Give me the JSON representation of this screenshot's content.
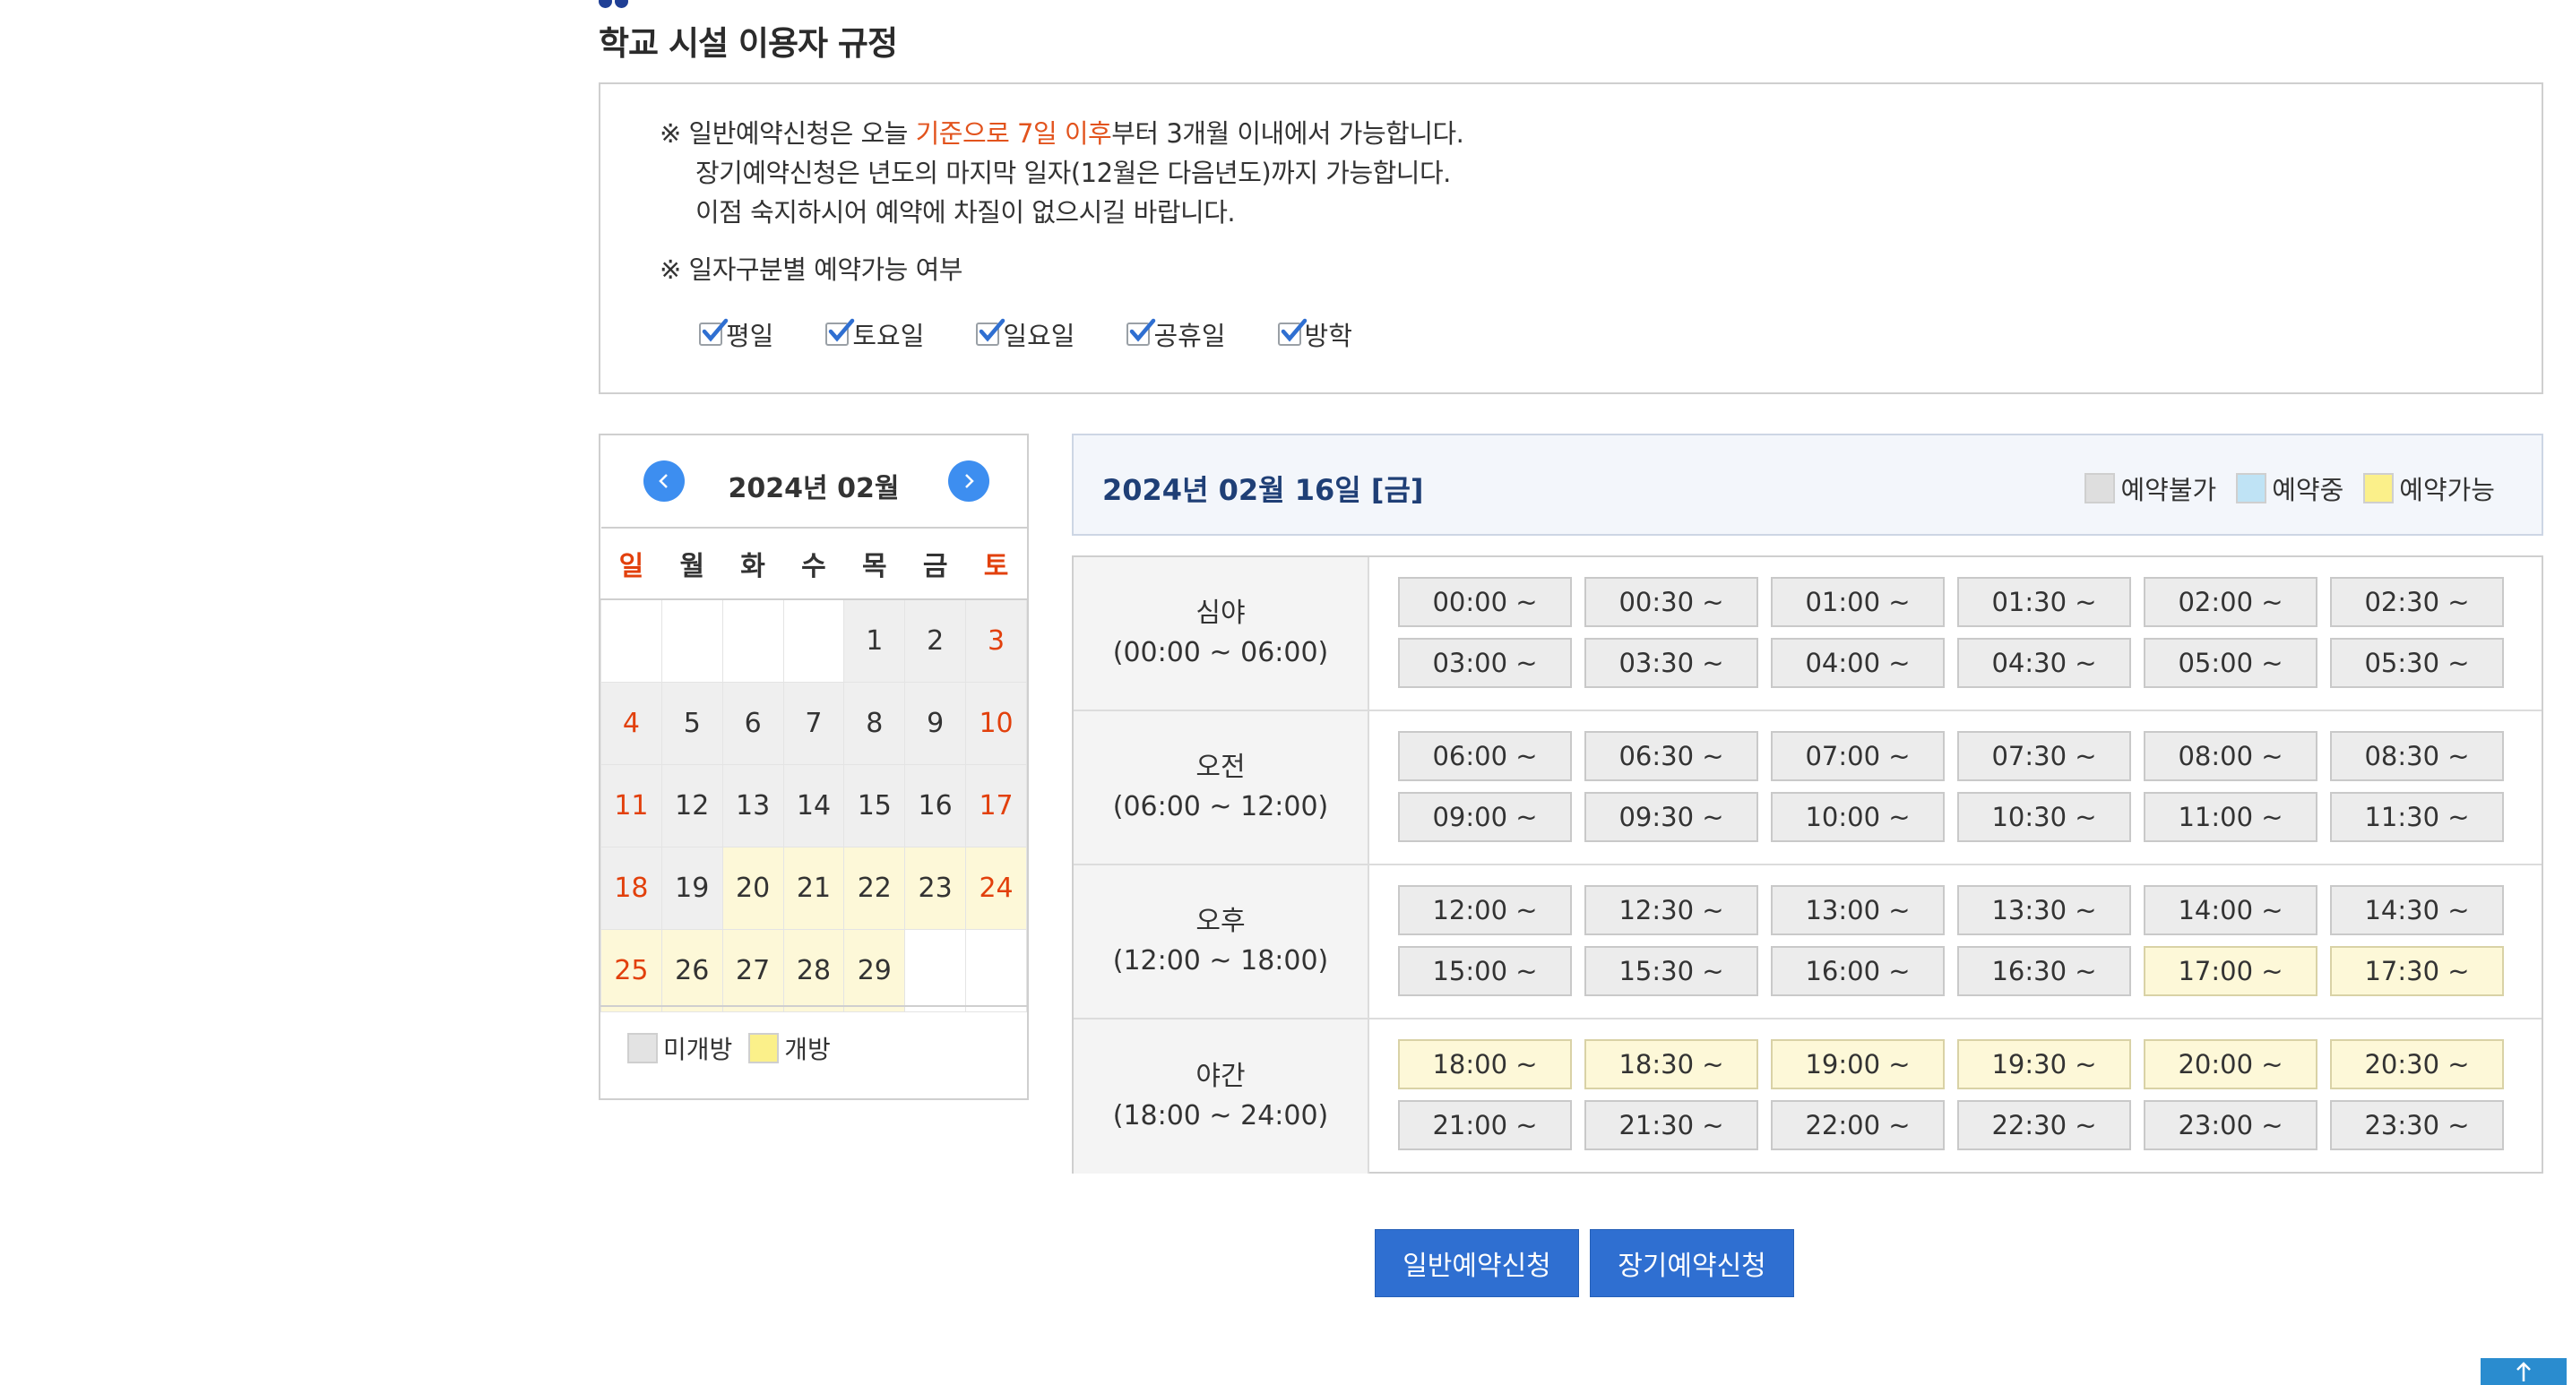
{
  "page": {
    "title": "학교 시설 이용자 규정"
  },
  "notice": {
    "line1_pre": "※ 일반예약신청은 오늘 ",
    "line1_highlight": "기준으로 7일 이후",
    "line1_post": "부터 3개월 이내에서 가능합니다.",
    "line2": "장기예약신청은 년도의 마지막 일자(12월은 다음년도)까지 가능합니다.",
    "line3": "이점 숙지하시어 예약에 차질이 없으시길 바랍니다.",
    "availability_heading": "※ 일자구분별 예약가능 여부",
    "options": [
      {
        "label": "평일",
        "checked": true
      },
      {
        "label": "토요일",
        "checked": true
      },
      {
        "label": "일요일",
        "checked": true
      },
      {
        "label": "공휴일",
        "checked": true
      },
      {
        "label": "방학",
        "checked": true
      }
    ]
  },
  "calendar": {
    "title": "2024년 02월",
    "prev_icon": "chevron-left-icon",
    "next_icon": "chevron-right-icon",
    "weekdays": [
      "일",
      "월",
      "화",
      "수",
      "목",
      "금",
      "토"
    ],
    "weeks": [
      [
        {
          "d": "",
          "s": "empty"
        },
        {
          "d": "",
          "s": "empty"
        },
        {
          "d": "",
          "s": "empty"
        },
        {
          "d": "",
          "s": "empty"
        },
        {
          "d": "1",
          "s": "closed"
        },
        {
          "d": "2",
          "s": "closed"
        },
        {
          "d": "3",
          "s": "closed"
        }
      ],
      [
        {
          "d": "4",
          "s": "closed"
        },
        {
          "d": "5",
          "s": "closed"
        },
        {
          "d": "6",
          "s": "closed"
        },
        {
          "d": "7",
          "s": "closed"
        },
        {
          "d": "8",
          "s": "closed"
        },
        {
          "d": "9",
          "s": "closed"
        },
        {
          "d": "10",
          "s": "closed"
        }
      ],
      [
        {
          "d": "11",
          "s": "closed"
        },
        {
          "d": "12",
          "s": "closed"
        },
        {
          "d": "13",
          "s": "closed"
        },
        {
          "d": "14",
          "s": "closed"
        },
        {
          "d": "15",
          "s": "closed"
        },
        {
          "d": "16",
          "s": "closed"
        },
        {
          "d": "17",
          "s": "closed"
        }
      ],
      [
        {
          "d": "18",
          "s": "closed"
        },
        {
          "d": "19",
          "s": "closed"
        },
        {
          "d": "20",
          "s": "open"
        },
        {
          "d": "21",
          "s": "open"
        },
        {
          "d": "22",
          "s": "open"
        },
        {
          "d": "23",
          "s": "open"
        },
        {
          "d": "24",
          "s": "open"
        }
      ],
      [
        {
          "d": "25",
          "s": "open"
        },
        {
          "d": "26",
          "s": "open"
        },
        {
          "d": "27",
          "s": "open"
        },
        {
          "d": "28",
          "s": "open"
        },
        {
          "d": "29",
          "s": "open"
        },
        {
          "d": "",
          "s": "empty"
        },
        {
          "d": "",
          "s": "empty"
        }
      ]
    ],
    "legend": [
      {
        "label": "미개방",
        "color": "#e3e3e3"
      },
      {
        "label": "개방",
        "color": "#fbf08a"
      }
    ]
  },
  "day": {
    "title": "2024년 02월 16일 [금]",
    "legend": [
      {
        "label": "예약불가",
        "color": "#dedede"
      },
      {
        "label": "예약중",
        "color": "#bfe3f5"
      },
      {
        "label": "예약가능",
        "color": "#fbf08a"
      }
    ]
  },
  "periods": [
    {
      "name": "심야",
      "range": "(00:00 ~ 06:00)",
      "slots": [
        {
          "t": "00:00 ~",
          "s": "unavailable"
        },
        {
          "t": "00:30 ~",
          "s": "unavailable"
        },
        {
          "t": "01:00 ~",
          "s": "unavailable"
        },
        {
          "t": "01:30 ~",
          "s": "unavailable"
        },
        {
          "t": "02:00 ~",
          "s": "unavailable"
        },
        {
          "t": "02:30 ~",
          "s": "unavailable"
        },
        {
          "t": "03:00 ~",
          "s": "unavailable"
        },
        {
          "t": "03:30 ~",
          "s": "unavailable"
        },
        {
          "t": "04:00 ~",
          "s": "unavailable"
        },
        {
          "t": "04:30 ~",
          "s": "unavailable"
        },
        {
          "t": "05:00 ~",
          "s": "unavailable"
        },
        {
          "t": "05:30 ~",
          "s": "unavailable"
        }
      ]
    },
    {
      "name": "오전",
      "range": "(06:00 ~ 12:00)",
      "slots": [
        {
          "t": "06:00 ~",
          "s": "unavailable"
        },
        {
          "t": "06:30 ~",
          "s": "unavailable"
        },
        {
          "t": "07:00 ~",
          "s": "unavailable"
        },
        {
          "t": "07:30 ~",
          "s": "unavailable"
        },
        {
          "t": "08:00 ~",
          "s": "unavailable"
        },
        {
          "t": "08:30 ~",
          "s": "unavailable"
        },
        {
          "t": "09:00 ~",
          "s": "unavailable"
        },
        {
          "t": "09:30 ~",
          "s": "unavailable"
        },
        {
          "t": "10:00 ~",
          "s": "unavailable"
        },
        {
          "t": "10:30 ~",
          "s": "unavailable"
        },
        {
          "t": "11:00 ~",
          "s": "unavailable"
        },
        {
          "t": "11:30 ~",
          "s": "unavailable"
        }
      ]
    },
    {
      "name": "오후",
      "range": "(12:00 ~ 18:00)",
      "slots": [
        {
          "t": "12:00 ~",
          "s": "unavailable"
        },
        {
          "t": "12:30 ~",
          "s": "unavailable"
        },
        {
          "t": "13:00 ~",
          "s": "unavailable"
        },
        {
          "t": "13:30 ~",
          "s": "unavailable"
        },
        {
          "t": "14:00 ~",
          "s": "unavailable"
        },
        {
          "t": "14:30 ~",
          "s": "unavailable"
        },
        {
          "t": "15:00 ~",
          "s": "unavailable"
        },
        {
          "t": "15:30 ~",
          "s": "unavailable"
        },
        {
          "t": "16:00 ~",
          "s": "unavailable"
        },
        {
          "t": "16:30 ~",
          "s": "unavailable"
        },
        {
          "t": "17:00 ~",
          "s": "available"
        },
        {
          "t": "17:30 ~",
          "s": "available"
        }
      ]
    },
    {
      "name": "야간",
      "range": "(18:00 ~ 24:00)",
      "slots": [
        {
          "t": "18:00 ~",
          "s": "available"
        },
        {
          "t": "18:30 ~",
          "s": "available"
        },
        {
          "t": "19:00 ~",
          "s": "available"
        },
        {
          "t": "19:30 ~",
          "s": "available"
        },
        {
          "t": "20:00 ~",
          "s": "available"
        },
        {
          "t": "20:30 ~",
          "s": "available"
        },
        {
          "t": "21:00 ~",
          "s": "unavailable"
        },
        {
          "t": "21:30 ~",
          "s": "unavailable"
        },
        {
          "t": "22:00 ~",
          "s": "unavailable"
        },
        {
          "t": "22:30 ~",
          "s": "unavailable"
        },
        {
          "t": "23:00 ~",
          "s": "unavailable"
        },
        {
          "t": "23:30 ~",
          "s": "unavailable"
        }
      ]
    }
  ],
  "buttons": {
    "general": "일반예약신청",
    "long_term": "장기예약신청"
  },
  "scroll_top_icon": "arrow-up-icon"
}
